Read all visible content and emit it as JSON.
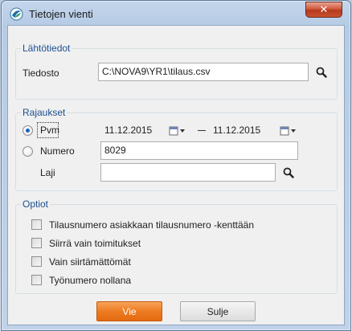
{
  "window": {
    "title": "Tietojen vienti",
    "close_label": "✕"
  },
  "source": {
    "group_title": "Lähtötiedot",
    "file_label": "Tiedosto",
    "file_value": "C:\\NOVA9\\YR1\\tilaus.csv"
  },
  "filters": {
    "group_title": "Rajaukset",
    "date_label": "Pvm",
    "date_selected": true,
    "date_from": "11.12.2015",
    "date_to": "11.12.2015",
    "number_label": "Numero",
    "number_selected": false,
    "number_value": "8029",
    "type_label": "Laji",
    "type_value": ""
  },
  "options": {
    "group_title": "Optiot",
    "items": [
      {
        "label": "Tilausnumero asiakkaan tilausnumero -kenttään",
        "checked": false
      },
      {
        "label": "Siirrä vain toimitukset",
        "checked": false
      },
      {
        "label": "Vain siirtämättömät",
        "checked": false
      },
      {
        "label": "Työnumero nollana",
        "checked": false
      }
    ]
  },
  "buttons": {
    "export_label": "Vie",
    "close_label": "Sulje"
  },
  "colors": {
    "accent": "#1d4f91",
    "primary_button": "#ed7b22",
    "close_button": "#c9522f"
  }
}
